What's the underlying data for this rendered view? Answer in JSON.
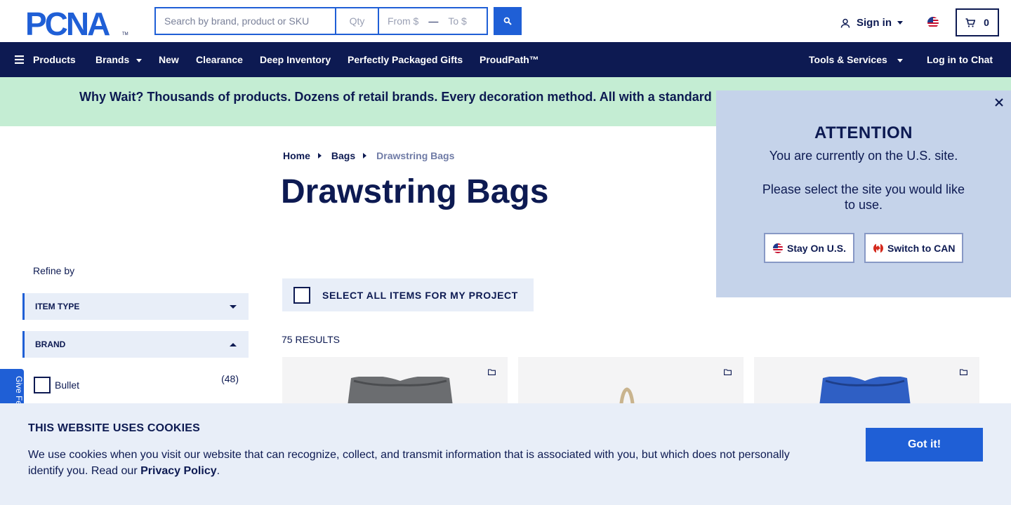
{
  "header": {
    "logo_text": "PCNA",
    "search": {
      "term_placeholder": "Search by brand, product or SKU",
      "qty_placeholder": "Qty",
      "from_placeholder": "From $",
      "to_placeholder": "To $"
    },
    "signin_label": "Sign in",
    "cart_count": "0",
    "region_icon": "us-flag-icon"
  },
  "nav": {
    "left": [
      {
        "label": "Products",
        "icon": "menu-icon"
      },
      {
        "label": "Brands",
        "has_caret": true
      },
      {
        "label": "New"
      },
      {
        "label": "Clearance"
      },
      {
        "label": "Deep Inventory"
      },
      {
        "label": "Perfectly Packaged Gifts"
      },
      {
        "label": "ProudPath™"
      }
    ],
    "right": [
      {
        "label": "Tools & Services",
        "has_caret": true
      },
      {
        "label": "Log in to Chat"
      }
    ]
  },
  "promo": {
    "text": "Why Wait? Thousands of products. Dozens of retail brands. Every decoration method. All with a standard"
  },
  "breadcrumb": {
    "home": "Home",
    "bags": "Bags",
    "current": "Drawstring Bags"
  },
  "page": {
    "title": "Drawstring Bags"
  },
  "sidebar": {
    "refine_label": "Refine by",
    "facets": {
      "item_type": "ITEM TYPE",
      "brand": "BRAND"
    },
    "brand_options": [
      {
        "label": "Bullet",
        "count": "(48)"
      }
    ],
    "feedback_label": "Give Feedback"
  },
  "results": {
    "select_all_label": "SELECT ALL ITEMS FOR MY PROJECT",
    "count_label": "75 RESULTS"
  },
  "attention_modal": {
    "heading": "ATTENTION",
    "line1": "You are currently on the U.S. site.",
    "line2": "Please select the site you would like to use.",
    "stay_label": "Stay On U.S.",
    "switch_label": "Switch to CAN"
  },
  "cookie_banner": {
    "title": "THIS WEBSITE USES COOKIES",
    "body_text": "We use cookies when you visit our website that can recognize, collect, and transmit information that is associated with you, but which does not personally identify you. Read our ",
    "privacy_link": "Privacy Policy",
    "body_end": ".",
    "accept_label": "Got it!"
  },
  "colors": {
    "navy": "#0d1a52",
    "blue": "#1f5fd6",
    "promo_green": "#c4edd3",
    "modal_blue": "#c5d3ea",
    "panel_gray": "#e8eef8"
  }
}
